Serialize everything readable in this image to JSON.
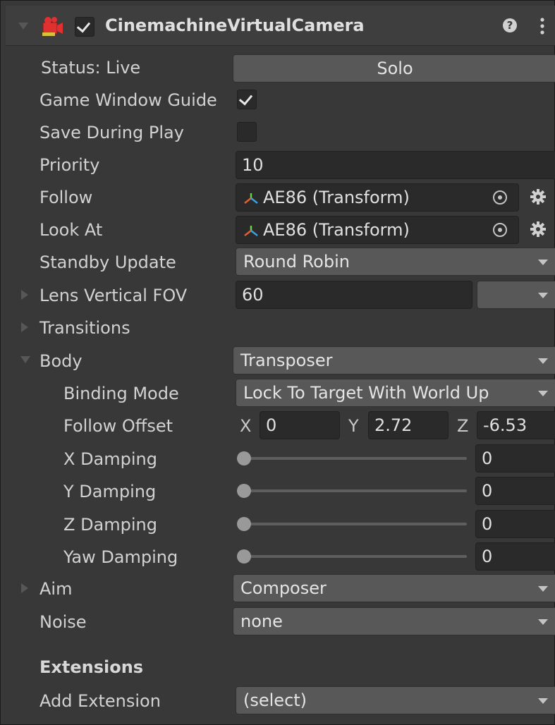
{
  "header": {
    "title": "CinemachineVirtualCamera",
    "enabled": true,
    "help_icon": "help-icon",
    "menu_icon": "kebab-menu-icon"
  },
  "rows": {
    "status": {
      "label": "Status: Live",
      "button": "Solo"
    },
    "game_window_guides": {
      "label": "Game Window Guide",
      "checked": true
    },
    "save_during_play": {
      "label": "Save During Play",
      "checked": false
    },
    "priority": {
      "label": "Priority",
      "value": "10"
    },
    "follow": {
      "label": "Follow",
      "value": "AE86 (Transform)"
    },
    "look_at": {
      "label": "Look At",
      "value": "AE86 (Transform)"
    },
    "standby_update": {
      "label": "Standby Update",
      "value": "Round Robin"
    },
    "lens": {
      "label": "Lens Vertical FOV",
      "value": "60"
    },
    "transitions": {
      "label": "Transitions"
    },
    "body": {
      "label": "Body",
      "value": "Transposer"
    },
    "binding_mode": {
      "label": "Binding Mode",
      "value": "Lock To Target With World Up"
    },
    "follow_offset": {
      "label": "Follow Offset",
      "x_label": "X",
      "x": "0",
      "y_label": "Y",
      "y": "2.72",
      "z_label": "Z",
      "z": "-6.53"
    },
    "x_damping": {
      "label": "X Damping",
      "value": "0"
    },
    "y_damping": {
      "label": "Y Damping",
      "value": "0"
    },
    "z_damping": {
      "label": "Z Damping",
      "value": "0"
    },
    "yaw_damping": {
      "label": "Yaw Damping",
      "value": "0"
    },
    "aim": {
      "label": "Aim",
      "value": "Composer"
    },
    "noise": {
      "label": "Noise",
      "value": "none"
    }
  },
  "extensions": {
    "heading": "Extensions",
    "add_label": "Add Extension",
    "add_value": "(select)"
  },
  "colors": {
    "background": "#383838",
    "field": "#2a2a2a",
    "button": "#585858",
    "component_icon": "#e03030"
  }
}
